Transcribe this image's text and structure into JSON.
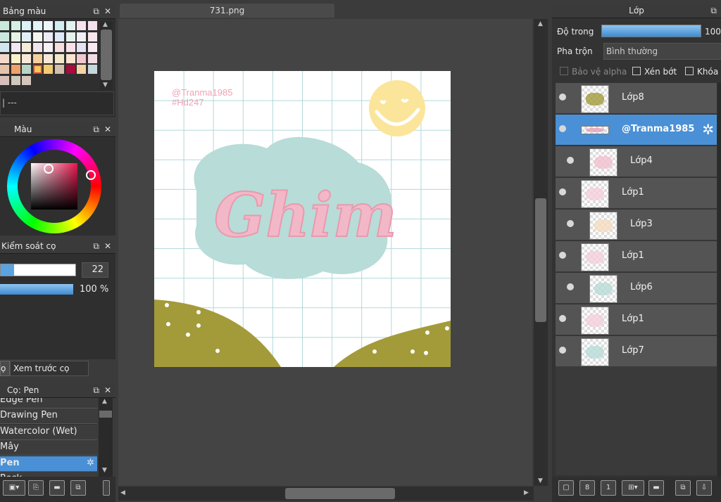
{
  "palette_panel": {
    "title": "Bảng màu",
    "colors": [
      "#c9e9dc",
      "#d5efe2",
      "#dbf2f6",
      "#e3f3fa",
      "#eef6fc",
      "#d2eef3",
      "#e2f3ed",
      "#f5e2ee",
      "#f7e0ec",
      "#cbe8e0",
      "#e6f3e3",
      "#e1f0f5",
      "#f3f4ee",
      "#eceaf7",
      "#dfe8f7",
      "#e4f1ef",
      "#f1eef7",
      "#f8e5ed",
      "#cfe5f0",
      "#f2e7f2",
      "#f4ecd9",
      "#f0e5ef",
      "#f6f1f4",
      "#f6dde0",
      "#f8dfea",
      "#e5e2f5",
      "#fae9f3",
      "#f3d9cc",
      "#fbf0c8",
      "#f8e8d9",
      "#f4ce9d",
      "#f6e7d9",
      "#f0e8c8",
      "#fbe3ce",
      "#f1c7d0",
      "#f3dbe3",
      "#e5c3ab",
      "#f1a06a",
      "#b8d4c8",
      "#f0cc5b",
      "#f3cb70",
      "#d3c0ae",
      "#a80c3b",
      "#f6d3a4",
      "#c5d7de",
      "#d8c0ba",
      "#d1c8b9",
      "#d5c6bd"
    ],
    "selected_index": 39,
    "name_value": "| ---"
  },
  "color_panel": {
    "title": "Màu"
  },
  "brush_control": {
    "title": "Kiểm soát cọ",
    "size_value": "22",
    "opacity_value": "100 %",
    "size_fill": 0.18,
    "opacity_fill": 1.0
  },
  "tabs": {
    "brush_tab": "ọ",
    "preview_tab": "Xem trước cọ"
  },
  "brush_list": {
    "title": "Cọ: Pen",
    "items": [
      "Edge Pen",
      "Drawing Pen",
      "Watercolor (Wet)",
      "Mây",
      "Pen",
      "Rock"
    ],
    "selected": "Pen"
  },
  "document": {
    "tab_title": "731.png",
    "watermark_line1": "@Tranma1985",
    "watermark_line2": "#Hd247",
    "art_text": "Ghim"
  },
  "layers_panel": {
    "title": "Lớp",
    "opacity_label": "Độ trong",
    "opacity_value": "100",
    "opacity_fill": 1.0,
    "blend_label": "Pha trộn",
    "blend_value": "Bình thường",
    "protect_alpha": "Bảo vệ alpha",
    "clip": "Xén bớt",
    "lock": "Khóa",
    "layers": [
      {
        "name": "Lớp8",
        "clipped": false,
        "selected": false
      },
      {
        "name": "@Tranma1985",
        "clipped": false,
        "selected": true
      },
      {
        "name": "Lớp4",
        "clipped": true,
        "selected": false
      },
      {
        "name": "Lớp1",
        "clipped": false,
        "selected": false
      },
      {
        "name": "Lớp3",
        "clipped": true,
        "selected": false
      },
      {
        "name": "Lớp1",
        "clipped": false,
        "selected": false
      },
      {
        "name": "Lớp6",
        "clipped": true,
        "selected": false
      },
      {
        "name": "Lớp1",
        "clipped": false,
        "selected": false
      },
      {
        "name": "Lớp7",
        "clipped": false,
        "selected": false
      }
    ]
  },
  "icons": {
    "popout": "popout-icon",
    "close": "close-icon",
    "settings": "gear-icon",
    "visibility": "eye-icon"
  }
}
